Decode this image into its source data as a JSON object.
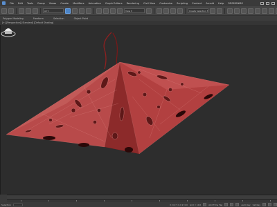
{
  "menu": {
    "items": [
      "File",
      "Edit",
      "Tools",
      "Group",
      "Views",
      "Create",
      "Modifiers",
      "Animation",
      "Graph Editors",
      "Rendering",
      "Civil View",
      "Customize",
      "Scripting",
      "Content",
      "Arnold",
      "Help",
      "3DSMGNMO"
    ]
  },
  "toolbar": {
    "selection_set": "Create Selection Se..."
  },
  "ribbon": {
    "tabs": [
      "Polygon Modeling",
      "Freeform",
      "Selection",
      "Object Paint"
    ]
  },
  "viewport": {
    "label": "[+] [Perspective] [Standard] [Default Shading]",
    "object_color": "#b84a4a",
    "object_dark": "#5a1414",
    "background": "#2d2d2d"
  },
  "status": {
    "mode": "Selection",
    "coords": "X: 0.0  Y: 0.0  Z: 0.0",
    "grid": "Grid = 10.0",
    "auto_key": "Auto Key",
    "set_key": "Set Key",
    "add_time_tag": "Add Time Tag"
  }
}
